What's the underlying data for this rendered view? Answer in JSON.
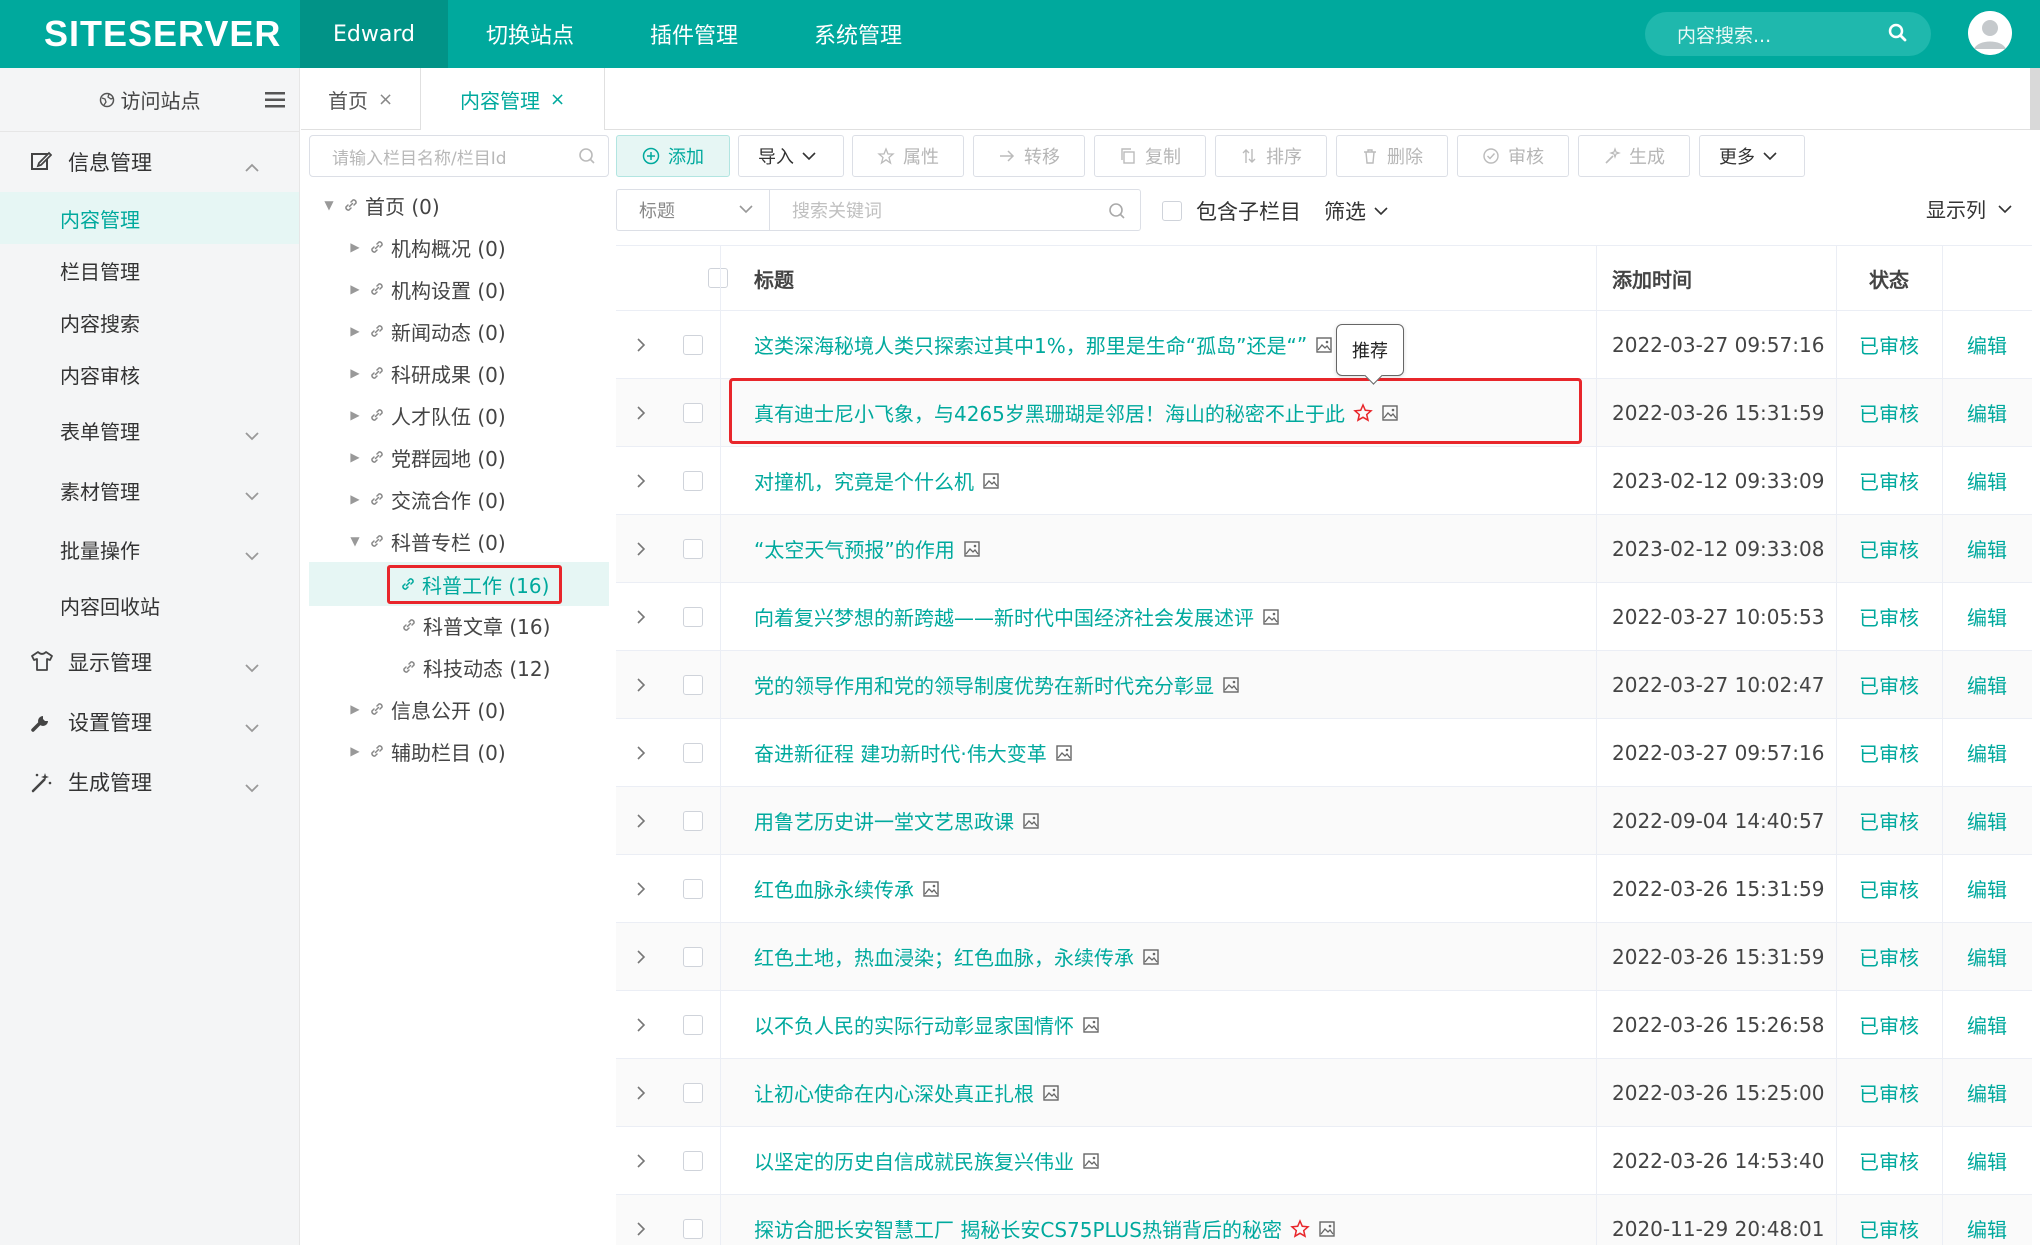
{
  "brand": {
    "logo": "SITESERVER",
    "accent": "#00a99d",
    "danger": "#e8262b"
  },
  "topnav": {
    "items": [
      "Edward",
      "切换站点",
      "插件管理",
      "系统管理"
    ],
    "search_placeholder": "内容搜索..."
  },
  "sidebar": {
    "visit": "访问站点",
    "groups": [
      {
        "label": "信息管理",
        "icon": "edit-icon"
      },
      {
        "label": "显示管理",
        "icon": "shirt-icon"
      },
      {
        "label": "设置管理",
        "icon": "wrench-icon"
      },
      {
        "label": "生成管理",
        "icon": "magic-wand-icon"
      }
    ],
    "sub_items": [
      "内容管理",
      "栏目管理",
      "内容搜索",
      "内容审核",
      "表单管理",
      "素材管理",
      "批量操作",
      "内容回收站"
    ]
  },
  "tabs": [
    {
      "label": "首页",
      "close": "×"
    },
    {
      "label": "内容管理",
      "close": "×"
    }
  ],
  "tree": {
    "search_placeholder": "请输入栏目名称/栏目Id",
    "nodes": [
      "首页 (0)",
      "机构概况 (0)",
      "机构设置 (0)",
      "新闻动态 (0)",
      "科研成果 (0)",
      "人才队伍 (0)",
      "党群园地 (0)",
      "交流合作 (0)",
      "科普专栏 (0)",
      "科普工作 (16)",
      "科普文章 (16)",
      "科技动态 (12)",
      "信息公开 (0)",
      "辅助栏目 (0)"
    ]
  },
  "toolbar": {
    "add": "添加",
    "import": "导入",
    "attr": "属性",
    "move": "转移",
    "copy": "复制",
    "sort": "排序",
    "delete": "删除",
    "audit": "审核",
    "generate": "生成",
    "more": "更多"
  },
  "filter": {
    "field": "标题",
    "keyword_placeholder": "搜索关键词",
    "include_sub": "包含子栏目",
    "filter_label": "筛选",
    "columns_label": "显示列"
  },
  "table": {
    "headers": {
      "title": "标题",
      "time": "添加时间",
      "status": "状态"
    },
    "status_text": "已审核",
    "edit_text": "编辑",
    "rows": [
      {
        "title": "这类深海秘境人类只探索过其中1%，那里是生命“孤岛”还是“",
        "title_tail": "”",
        "time": "2022-03-27 09:57:16"
      },
      {
        "title": "真有迪士尼小飞象，与4265岁黑珊瑚是邻居！海山的秘密不止于此",
        "time": "2022-03-26 15:31:59"
      },
      {
        "title": "对撞机，究竟是个什么机",
        "time": "2023-02-12 09:33:09"
      },
      {
        "title": "“太空天气预报”的作用",
        "time": "2023-02-12 09:33:08"
      },
      {
        "title": "向着复兴梦想的新跨越——新时代中国经济社会发展述评",
        "time": "2022-03-27 10:05:53"
      },
      {
        "title": "党的领导作用和党的领导制度优势在新时代充分彰显",
        "time": "2022-03-27 10:02:47"
      },
      {
        "title": "奋进新征程 建功新时代·伟大变革",
        "time": "2022-03-27 09:57:16"
      },
      {
        "title": "用鲁艺历史讲一堂文艺思政课",
        "time": "2022-09-04 14:40:57"
      },
      {
        "title": "红色血脉永续传承",
        "time": "2022-03-26 15:31:59"
      },
      {
        "title": "红色土地，热血浸染；红色血脉，永续传承",
        "time": "2022-03-26 15:31:59"
      },
      {
        "title": "以不负人民的实际行动彰显家国情怀",
        "time": "2022-03-26 15:26:58"
      },
      {
        "title": "让初心使命在内心深处真正扎根",
        "time": "2022-03-26 15:25:00"
      },
      {
        "title": "以坚定的历史自信成就民族复兴伟业",
        "time": "2022-03-26 14:53:40"
      },
      {
        "title": "探访合肥长安智慧工厂 揭秘长安CS75PLUS热销背后的秘密",
        "time": "2020-11-29 20:48:01"
      }
    ]
  },
  "tooltip": "推荐"
}
